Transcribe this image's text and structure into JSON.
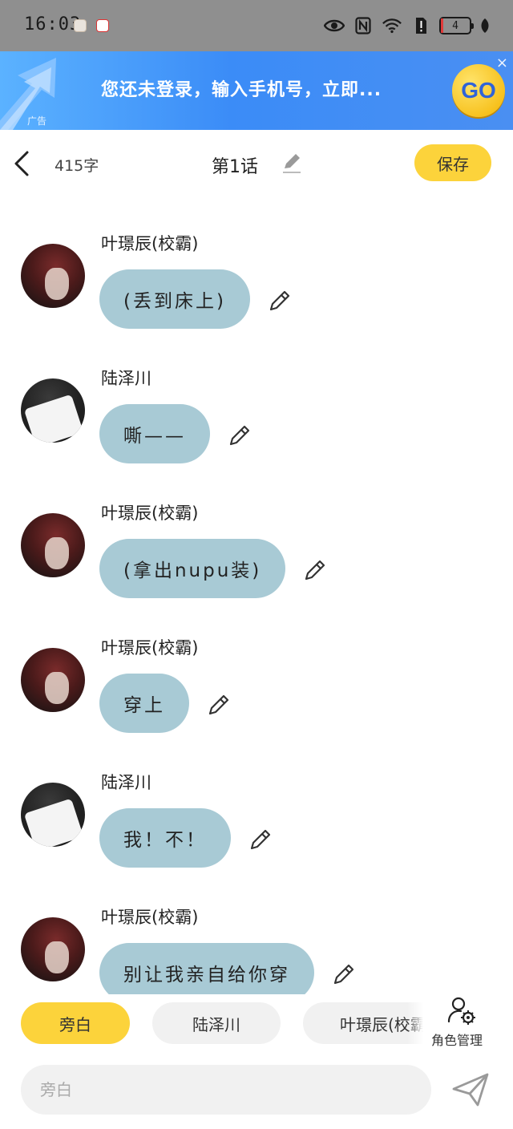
{
  "status_bar": {
    "time": "16:03",
    "battery": "4"
  },
  "ad": {
    "text": "您还未登录，输入手机号，立即...",
    "go_label": "GO",
    "close": "×",
    "tag": "广告"
  },
  "header": {
    "word_count": "415字",
    "title": "第1话",
    "save_label": "保存"
  },
  "messages": [
    {
      "speaker": "叶璟辰(校霸)",
      "text": "(丢到床上)",
      "avatar": "avatar-red-hair"
    },
    {
      "speaker": "陆泽川",
      "text": "嘶——",
      "avatar": "avatar-black-hair"
    },
    {
      "speaker": "叶璟辰(校霸)",
      "text": "(拿出nupu装)",
      "avatar": "avatar-red-hair"
    },
    {
      "speaker": "叶璟辰(校霸)",
      "text": "穿上",
      "avatar": "avatar-red-hair"
    },
    {
      "speaker": "陆泽川",
      "text": "我！不！",
      "avatar": "avatar-black-hair"
    },
    {
      "speaker": "叶璟辰(校霸)",
      "text": "别让我亲自给你穿",
      "avatar": "avatar-red-hair"
    }
  ],
  "roles": {
    "items": [
      {
        "label": "旁白",
        "active": true
      },
      {
        "label": "陆泽川",
        "active": false
      },
      {
        "label": "叶璟辰(校霸)",
        "active": false
      }
    ],
    "manage_label": "角色管理"
  },
  "input": {
    "placeholder": "旁白"
  },
  "colors": {
    "accent": "#fcd33b",
    "bubble": "#a8cad5",
    "chip_inactive": "#f1f1f1",
    "ad_blue": "#3b8cf7"
  }
}
